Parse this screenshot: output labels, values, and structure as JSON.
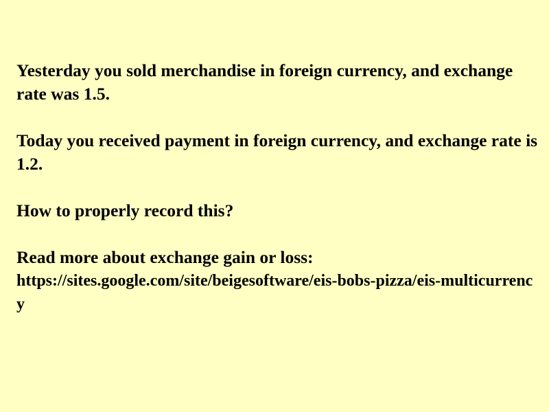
{
  "slide": {
    "paragraphs": [
      "Yesterday you sold merchandise in foreign currency, and exchange rate was 1.5.",
      "Today you received payment in foreign currency, and exchange rate is 1.2.",
      "How to properly record this?",
      "Read more about exchange gain or loss:"
    ],
    "link": "https://sites.google.com/site/beigesoftware/eis-bobs-pizza/eis-multicurrency"
  },
  "colors": {
    "background": "#ffffc4",
    "text": "#000000"
  }
}
